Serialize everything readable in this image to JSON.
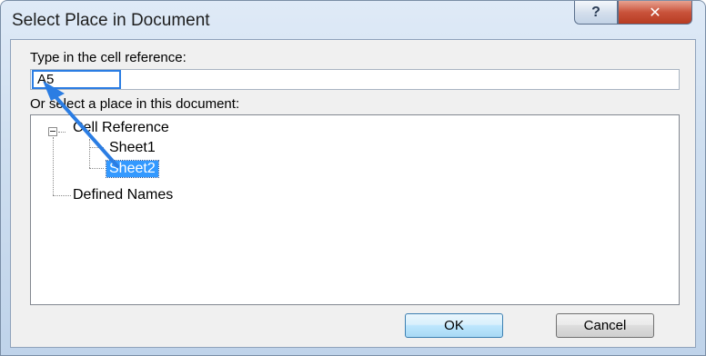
{
  "dialog": {
    "title": "Select Place in Document",
    "help_symbol": "?",
    "close_symbol": "✕"
  },
  "reference": {
    "label": "Type in the cell reference:",
    "value": "A5"
  },
  "place": {
    "label": "Or select a place in this document:",
    "tree": {
      "root_label": "Cell Reference",
      "items": [
        "Sheet1",
        "Sheet2"
      ],
      "selected": "Sheet2",
      "defined_names_label": "Defined Names"
    }
  },
  "buttons": {
    "ok": "OK",
    "cancel": "Cancel"
  },
  "colors": {
    "selection": "#3399ff",
    "annotation_arrow": "#2b7de3"
  }
}
